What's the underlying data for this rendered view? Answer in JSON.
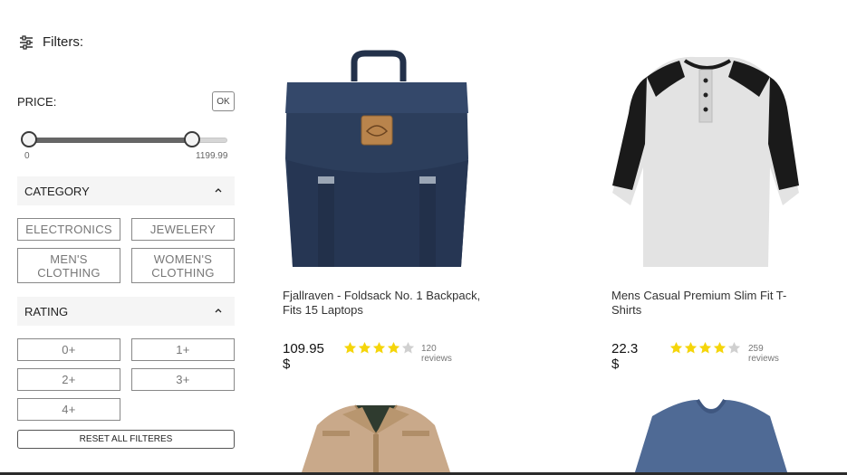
{
  "sidebar": {
    "filters_title": "Filters:",
    "price_label": "PRICE:",
    "ok_label": "OK",
    "price_min": "0",
    "price_max": "1199.99",
    "price_value_fraction": 0.85,
    "category_title": "CATEGORY",
    "categories": [
      "ELECTRONICS",
      "JEWELERY",
      "MEN'S CLOTHING",
      "WOMEN'S CLOTHING"
    ],
    "rating_title": "RATING",
    "ratings": [
      "0+",
      "1+",
      "2+",
      "3+",
      "4+"
    ],
    "reset_label": "RESET ALL FILTERES"
  },
  "products": [
    {
      "title": "Fjallraven - Foldsack No. 1 Backpack, Fits 15 Laptops",
      "price": "109.95 $",
      "rating": 4,
      "reviews": "120 reviews",
      "image_icon": "backpack-image"
    },
    {
      "title": "Mens Casual Premium Slim Fit T-Shirts",
      "price": "22.3 $",
      "rating": 4,
      "reviews": "259 reviews",
      "image_icon": "tshirt-image"
    },
    {
      "image_icon": "jacket-image"
    },
    {
      "image_icon": "tee-image"
    }
  ],
  "colors": {
    "star_filled": "#F5D50A",
    "star_empty": "#D0D0D0",
    "backpack": "#2C3E5C",
    "shirt_body": "#E3E3E3",
    "shirt_sleeve": "#1A1A1A",
    "jacket": "#C9A98A",
    "tee": "#4F6A95"
  }
}
